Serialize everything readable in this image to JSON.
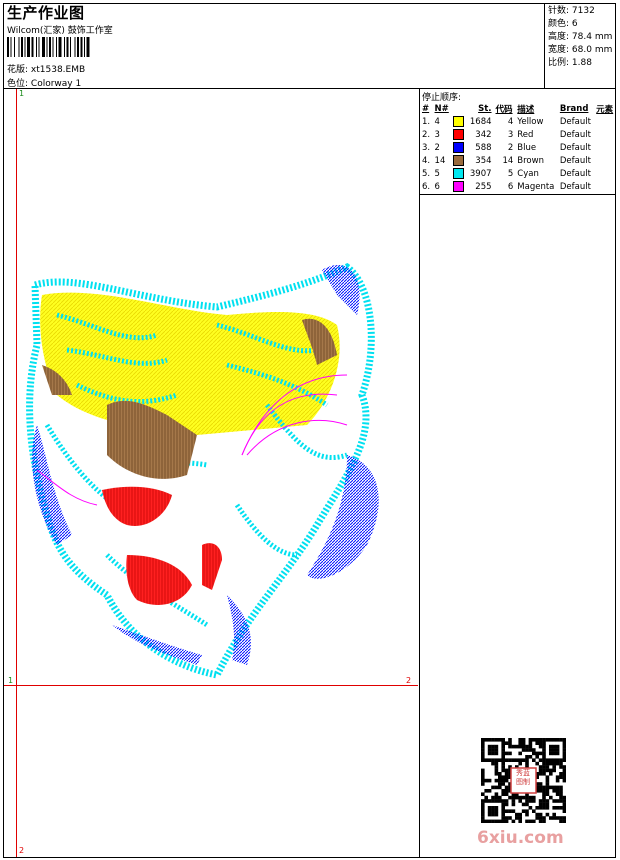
{
  "header": {
    "title": "生产作业图",
    "company": "Wilcom(汇家) 鼓饰工作室",
    "design_label": "花版:",
    "design_file": "xt1538.EMB",
    "colorway_label": "色位:",
    "colorway": "Colorway 1"
  },
  "stats": [
    {
      "label": "针数:",
      "value": "7132"
    },
    {
      "label": "颜色:",
      "value": "6"
    },
    {
      "label": "高度:",
      "value": "78.4 mm"
    },
    {
      "label": "宽度:",
      "value": "68.0 mm"
    },
    {
      "label": "比例:",
      "value": "1.88"
    }
  ],
  "stop_sequence": {
    "heading": "停止顺序:",
    "columns": [
      "#",
      "N#",
      "St.",
      "代码",
      "描述",
      "Brand",
      "元素"
    ],
    "rows": [
      {
        "idx": "1.",
        "n": "4",
        "st": "1684",
        "code": "4",
        "desc": "Yellow",
        "brand": "Default",
        "color": "#ffff00"
      },
      {
        "idx": "2.",
        "n": "3",
        "st": "342",
        "code": "3",
        "desc": "Red",
        "brand": "Default",
        "color": "#ff0000"
      },
      {
        "idx": "3.",
        "n": "2",
        "st": "588",
        "code": "2",
        "desc": "Blue",
        "brand": "Default",
        "color": "#0000ff"
      },
      {
        "idx": "4.",
        "n": "14",
        "st": "354",
        "code": "14",
        "desc": "Brown",
        "brand": "Default",
        "color": "#9a6a3c"
      },
      {
        "idx": "5.",
        "n": "5",
        "st": "3907",
        "code": "5",
        "desc": "Cyan",
        "brand": "Default",
        "color": "#00e8f0"
      },
      {
        "idx": "6.",
        "n": "6",
        "st": "255",
        "code": "6",
        "desc": "Magenta",
        "brand": "Default",
        "color": "#ff00ff"
      }
    ]
  },
  "canvas": {
    "marker_top": "1",
    "marker_left": "1",
    "marker_right": "2",
    "marker_bottom": "2"
  },
  "watermark": "6xiu.com",
  "qr_stamp": "秀蓝 图制"
}
